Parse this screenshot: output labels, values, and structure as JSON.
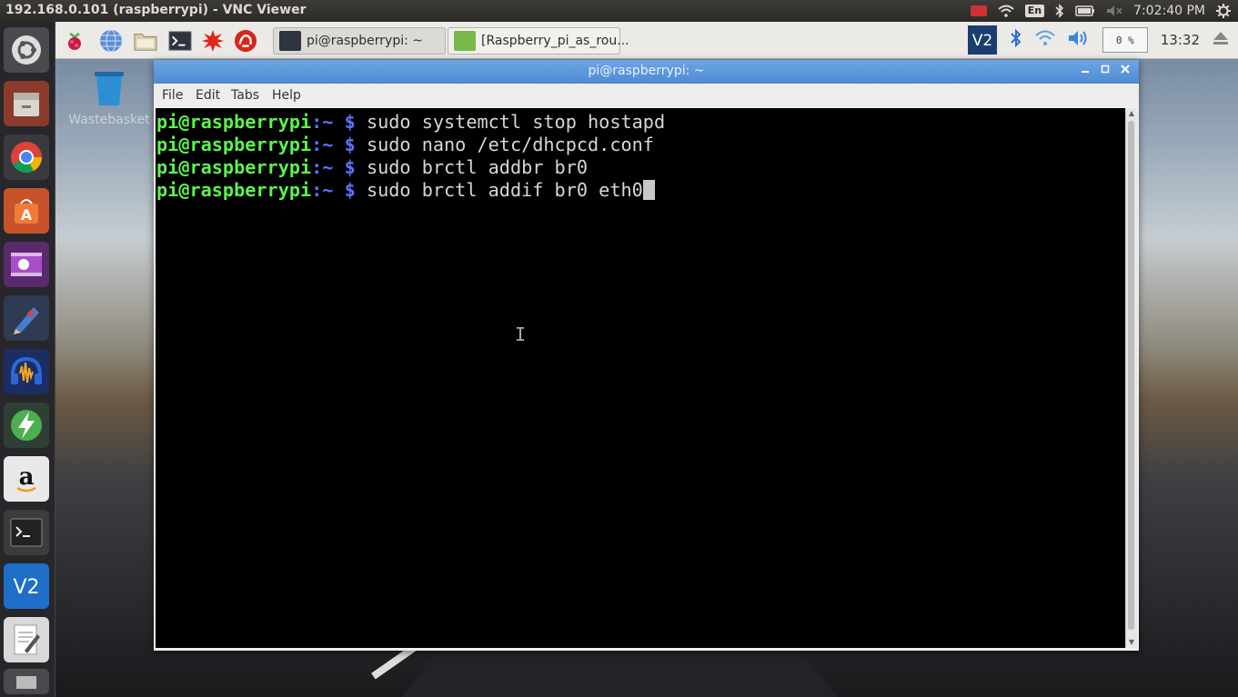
{
  "host": {
    "title": "192.168.0.101 (raspberrypi) - VNC Viewer",
    "keyboard_layout": "En",
    "clock": "7:02:40 PM"
  },
  "launcher": {
    "items": [
      "ubuntu-home-icon",
      "files-icon",
      "chrome-icon",
      "software-center-icon",
      "video-icon",
      "editor-icon",
      "audacity-icon",
      "power-icon",
      "amazon-icon",
      "terminal-icon",
      "vnc-icon",
      "text-editor-icon",
      "more-icon"
    ]
  },
  "rpi_panel": {
    "tasks": [
      {
        "label": "pi@raspberrypi: ~"
      },
      {
        "label": "[Raspberry_pi_as_rou..."
      }
    ],
    "cpu": "0 %",
    "clock": "13:32"
  },
  "desktop": {
    "wastebasket_label": "Wastebasket"
  },
  "terminal": {
    "title": "pi@raspberrypi: ~",
    "menu": [
      "File",
      "Edit",
      "Tabs",
      "Help"
    ],
    "prompt_user": "pi@raspberrypi",
    "prompt_path": ":~ $",
    "lines": [
      "sudo systemctl stop hostapd",
      "sudo nano /etc/dhcpcd.conf",
      "sudo brctl addbr br0",
      "sudo brctl addif br0 eth0"
    ]
  },
  "colors": {
    "prompt_user": "#5df24f",
    "prompt_path": "#5d73ff",
    "titlebar": "#5b95dc"
  }
}
